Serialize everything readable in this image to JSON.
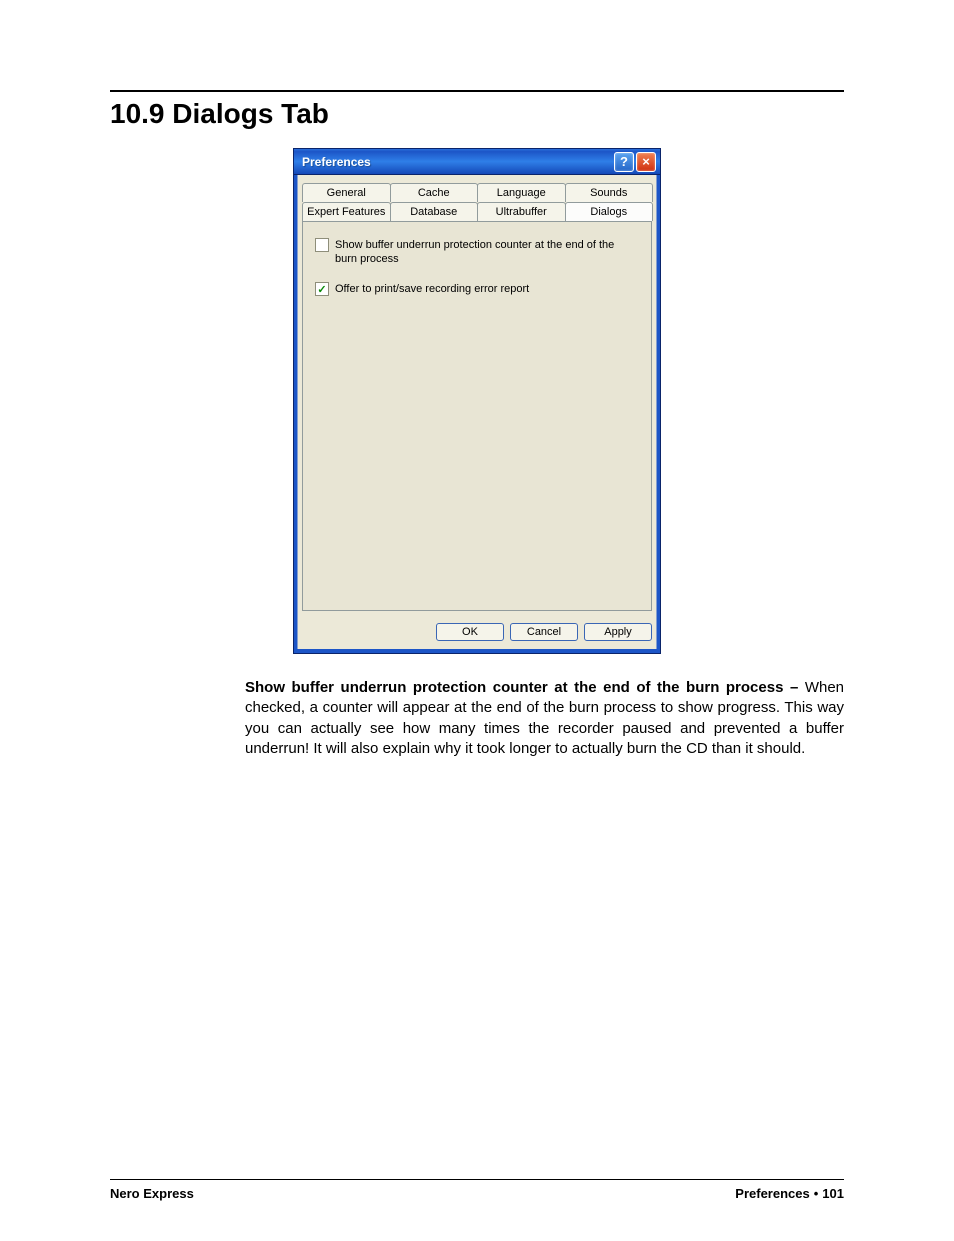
{
  "section": {
    "heading": "10.9  Dialogs Tab"
  },
  "dialog": {
    "title": "Preferences",
    "tabs_row1": [
      "General",
      "Cache",
      "Language",
      "Sounds"
    ],
    "tabs_row2": [
      "Expert Features",
      "Database",
      "Ultrabuffer",
      "Dialogs"
    ],
    "active_tab": "Dialogs",
    "check1": {
      "checked": false,
      "label": "Show buffer underrun protection counter at the end of the burn process"
    },
    "check2": {
      "checked": true,
      "label": "Offer to print/save recording error report"
    },
    "buttons": {
      "ok": "OK",
      "cancel": "Cancel",
      "apply": "Apply"
    }
  },
  "body": {
    "bold_lead": "Show buffer underrun protection counter at the end of the burn process –",
    "rest": " When checked, a counter will appear at the end of the burn process to show progress. This way you can actually see how many times the recorder paused and prevented a buffer underrun! It will also explain why it took longer to actually burn the CD than it should."
  },
  "footer": {
    "left": "Nero Express",
    "right_label": "Preferences",
    "right_page": "101"
  }
}
